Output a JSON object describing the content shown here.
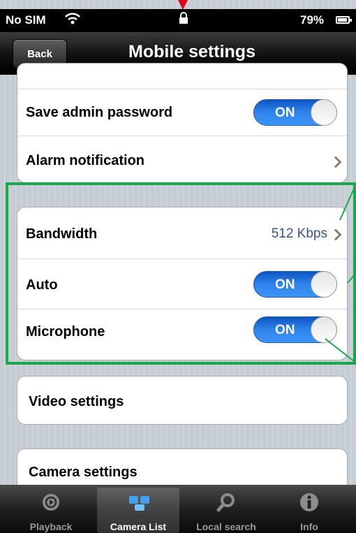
{
  "status_bar": {
    "carrier": "No SIM",
    "battery_percent": "79%"
  },
  "nav": {
    "back_label": "Back",
    "title": "Mobile settings"
  },
  "group1": {
    "save_admin_password": {
      "label": "Save admin password",
      "toggle": "ON"
    },
    "alarm_notification": {
      "label": "Alarm notification"
    }
  },
  "group2": {
    "bandwidth": {
      "label": "Bandwidth",
      "value": "512 Kbps"
    },
    "auto": {
      "label": "Auto",
      "toggle": "ON"
    },
    "microphone": {
      "label": "Microphone",
      "toggle": "ON"
    }
  },
  "video_settings": {
    "label": "Video settings"
  },
  "camera_settings": {
    "label": "Camera settings"
  },
  "tabs": [
    {
      "label": "Playback",
      "icon": "playback-icon",
      "selected": false
    },
    {
      "label": "Camera List",
      "icon": "camera-list-icon",
      "selected": true
    },
    {
      "label": "Local search",
      "icon": "search-icon",
      "selected": false
    },
    {
      "label": "Info",
      "icon": "info-icon",
      "selected": false
    }
  ],
  "colors": {
    "toggle_on": "#2e84ec",
    "highlight": "#1aa74d",
    "value_text": "#385487",
    "arrow": "#e0001b"
  }
}
